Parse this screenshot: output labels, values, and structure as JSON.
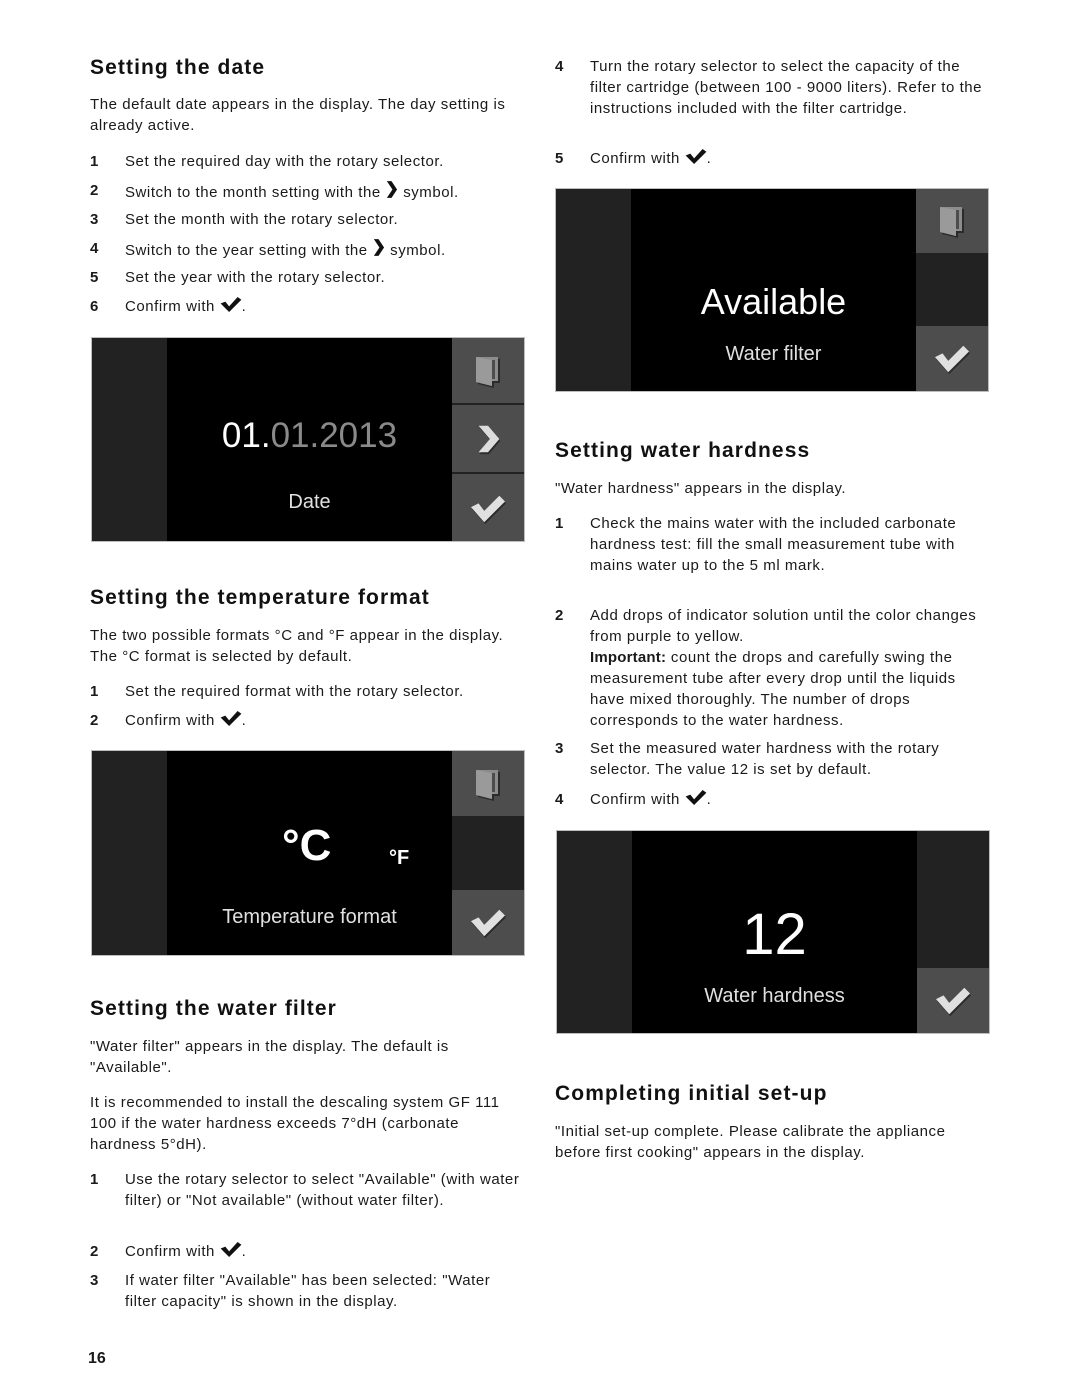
{
  "page_number": "16",
  "sections": {
    "date": {
      "title": "Setting the date",
      "intro": "The default date appears in the display. The day setting is already active.",
      "steps": [
        {
          "num": "1",
          "text": "Set the required day with the rotary selector."
        },
        {
          "num": "2",
          "pre": "Switch to the month setting with the",
          "post": "symbol."
        },
        {
          "num": "3",
          "text": "Set the month with the rotary selector."
        },
        {
          "num": "4",
          "pre": "Switch to the year setting with the",
          "post": "symbol."
        },
        {
          "num": "5",
          "text": "Set the year with the rotary selector."
        },
        {
          "num": "6",
          "pre": "Confirm with",
          "post": "."
        }
      ],
      "display": {
        "value_active": "01.",
        "value_inactive": "01.2013",
        "label": "Date",
        "buttons": [
          "door-icon",
          "chevron-right-icon",
          "check-icon"
        ]
      }
    },
    "temperature": {
      "title": "Setting the temperature format",
      "intro": "The two possible formats °C and °F appear in the display. The °C format is selected by default.",
      "steps": [
        {
          "num": "1",
          "text": "Set the required format with the rotary selector."
        },
        {
          "num": "2",
          "pre": "Confirm with",
          "post": "."
        }
      ],
      "display": {
        "option_selected": "°C",
        "option_other": "°F",
        "label": "Temperature format",
        "buttons": [
          "door-icon",
          "",
          "check-icon"
        ]
      }
    },
    "water_filter": {
      "title": "Setting the water filter",
      "intro": "\"Water filter\" appears in the display. The default is \"Available\".",
      "note": "It is recommended to install the descaling system GF 111 100 if the water hardness exceeds 7°dH (carbonate hardness 5°dH).",
      "steps": [
        {
          "num": "1",
          "text": "Use the rotary selector to select \"Available\" (with water filter) or \"Not available\" (without water filter)."
        },
        {
          "num": "2",
          "pre": "Confirm with",
          "post": "."
        },
        {
          "num": "3",
          "text": "If water filter \"Available\" has been selected: \"Water filter capacity\" is shown in the display."
        },
        {
          "num": "4",
          "text": "Turn the rotary selector to select the capacity of the filter cartridge (between 100 - 9000 liters). Refer to the instructions included with the filter cartridge."
        },
        {
          "num": "5",
          "pre": "Confirm with",
          "post": "."
        }
      ],
      "display": {
        "value": "Available",
        "label": "Water filter",
        "buttons": [
          "door-icon",
          "",
          "check-icon"
        ]
      }
    },
    "water_hardness": {
      "title": "Setting water hardness",
      "intro": "\"Water hardness\" appears in the display.",
      "steps": [
        {
          "num": "1",
          "text": "Check the mains water with the included carbonate hardness test: fill the small measurement tube with mains water up to the 5 ml mark."
        },
        {
          "num": "2",
          "text": "Add drops of indicator solution until the color changes from purple to yellow.",
          "important_label": "Important:",
          "important_text": "count the drops and carefully swing the measurement tube after every drop until the liquids have mixed thoroughly. The number of drops corresponds to the water hardness."
        },
        {
          "num": "3",
          "text": "Set the measured water hardness with the rotary selector. The value 12 is set by default."
        },
        {
          "num": "4",
          "pre": "Confirm with",
          "post": "."
        }
      ],
      "display": {
        "value": "12",
        "label": "Water hardness",
        "buttons": [
          "",
          "",
          "check-icon"
        ]
      }
    },
    "complete": {
      "title": "Completing initial set-up",
      "intro": "\"Initial set-up complete. Please calibrate the appliance before first cooking\" appears in the display."
    }
  },
  "colors": {
    "display_bg": "#000000",
    "side_bar": "#222222",
    "button_bg": "#4d4d4d",
    "icon_fill": "#d9d9d9",
    "inactive_text": "#8a8a8a"
  }
}
